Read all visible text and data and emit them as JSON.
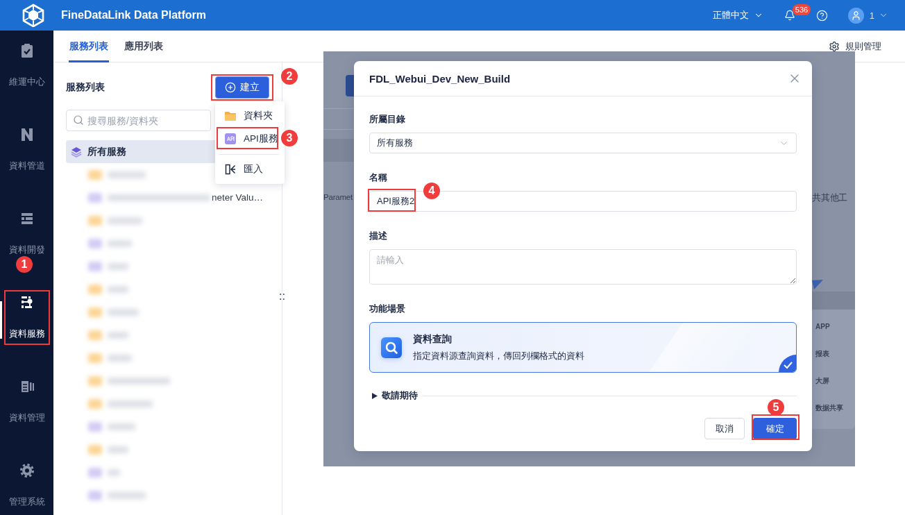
{
  "topbar": {
    "title": "FineDataLink Data Platform",
    "language": "正體中文",
    "notification_count": "536",
    "account_label": "1"
  },
  "sidebar": {
    "items": [
      {
        "label": "維運中心",
        "selected": false
      },
      {
        "label": "資料管道",
        "selected": false
      },
      {
        "label": "資料開發",
        "selected": false
      },
      {
        "label": "資料服務",
        "selected": true,
        "annotation": "1"
      },
      {
        "label": "資料管理",
        "selected": false
      },
      {
        "label": "管理系統",
        "selected": false
      }
    ]
  },
  "tabs": [
    {
      "label": "服務列表",
      "selected": true
    },
    {
      "label": "應用列表",
      "selected": false
    }
  ],
  "rules_link": "規則管理",
  "service_panel": {
    "title": "服務列表",
    "create_button": {
      "label": "建立",
      "annotation": "2"
    },
    "create_menu": {
      "groups": [
        {
          "items": [
            {
              "kind": "folder",
              "label": "資料夾"
            },
            {
              "kind": "api",
              "label": "API服務",
              "annotation": "3"
            }
          ]
        },
        {
          "items": [
            {
              "kind": "import",
              "label": "匯入"
            }
          ]
        }
      ]
    },
    "search": {
      "placeholder": "搜尋服務/資料夾"
    },
    "tree": {
      "root": {
        "label": "所有服務",
        "selected": true,
        "children": [
          {
            "kind": "folder"
          },
          {
            "kind": "api",
            "label": "neter Valu…"
          },
          {
            "kind": "folder"
          },
          {
            "kind": "api"
          },
          {
            "kind": "api"
          },
          {
            "kind": "folder"
          },
          {
            "kind": "folder"
          },
          {
            "kind": "folder"
          },
          {
            "kind": "folder"
          },
          {
            "kind": "folder"
          },
          {
            "kind": "folder"
          },
          {
            "kind": "api"
          },
          {
            "kind": "folder"
          },
          {
            "kind": "api"
          },
          {
            "kind": "api"
          }
        ]
      }
    }
  },
  "dimmed_background": {
    "left_fragment": "Paramet",
    "right_fragment": "共其他工",
    "side_list": [
      "APP",
      "报表",
      "大屏",
      "数据共享"
    ]
  },
  "dialog": {
    "title": "FDL_Webui_Dev_New_Build",
    "fields": [
      {
        "kind": "select",
        "label": "所屬目錄",
        "value": "所有服務"
      },
      {
        "kind": "input",
        "label": "名稱",
        "value": "API服務2",
        "annotation": "4"
      },
      {
        "kind": "textarea",
        "label": "描述",
        "placeholder": "請輸入"
      }
    ],
    "scenario_label": "功能場景",
    "scenarios": [
      {
        "title": "資料查詢",
        "description": "指定資料源查詢資料，傳回列欄格式的資料",
        "selected": true
      }
    ],
    "more_section": {
      "label": "敬請期待",
      "expanded": false
    },
    "buttons": [
      {
        "kind": "secondary",
        "label": "取消"
      },
      {
        "kind": "primary",
        "label": "確定",
        "annotation": "5"
      }
    ]
  }
}
